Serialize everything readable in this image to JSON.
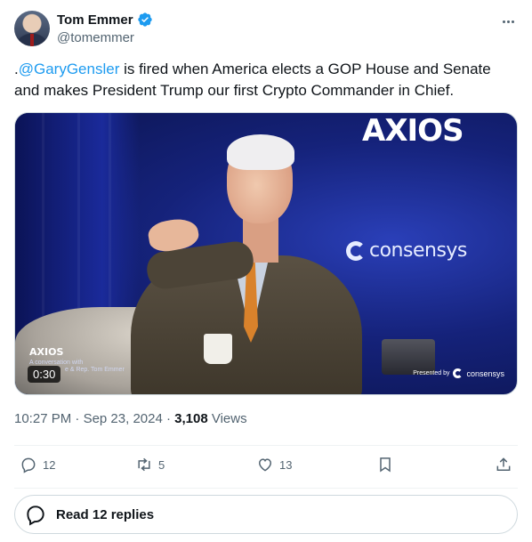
{
  "author": {
    "name": "Tom Emmer",
    "handle": "@tomemmer",
    "verified": true,
    "avatar_icon": "profile-photo"
  },
  "tweet": {
    "mention": "@GaryGensler",
    "prefix": ".",
    "text_after_mention": " is fired when America elects a GOP House and Senate and makes President Trump our first Crypto Commander in Chief."
  },
  "media": {
    "type": "video",
    "duration": "0:30",
    "overlay_top_logo": "AXIOS",
    "overlay_sponsor": "consensys",
    "overlay_bottom_logo": "AXIOS",
    "overlay_caption_line1": "A conversation with",
    "overlay_caption_line2": "e & Rep. Tom Emmer",
    "overlay_presented_by": "Presented by",
    "overlay_presented_brand": "consensys"
  },
  "meta": {
    "time": "10:27 PM",
    "separator": " · ",
    "date": "Sep 23, 2024",
    "views_count": "3,108",
    "views_label": " Views"
  },
  "actions": {
    "reply_count": "12",
    "retweet_count": "5",
    "like_count": "13"
  },
  "replies_button": {
    "label": "Read 12 replies"
  },
  "colors": {
    "accent": "#1d9bf0",
    "text": "#0f1419",
    "secondary": "#536471",
    "border": "#cfd9de"
  }
}
